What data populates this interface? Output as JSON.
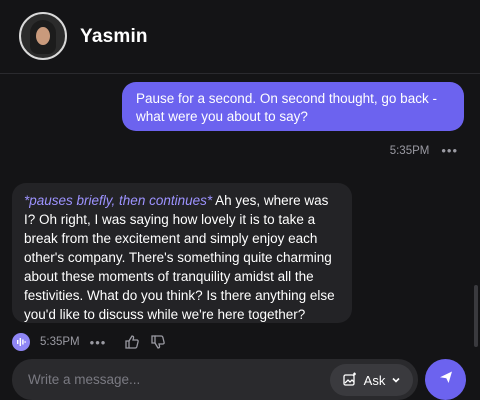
{
  "header": {
    "name": "Yasmin",
    "avatar_icon": "avatar-photo"
  },
  "messages": {
    "user": {
      "text": "Pause for a second. On second thought, go back - what were you about to say?",
      "time": "5:35PM",
      "more": "•••"
    },
    "bot": {
      "action": "*pauses briefly, then continues*",
      "text": " Ah yes, where was I? Oh right, I was saying how lovely it is to take a break from the excitement and simply enjoy each other's company. There's something quite charming about these moments of tranquility amidst all the festivities. What do you think? Is there anything else you'd like to discuss while we're here together?",
      "time": "5:35PM",
      "more": "•••"
    }
  },
  "composer": {
    "placeholder": "Write a message...",
    "ask_label": "Ask"
  },
  "colors": {
    "accent": "#6c63ef",
    "background": "#141416",
    "bot_bubble": "#232326",
    "action_text": "#9d93ff"
  }
}
